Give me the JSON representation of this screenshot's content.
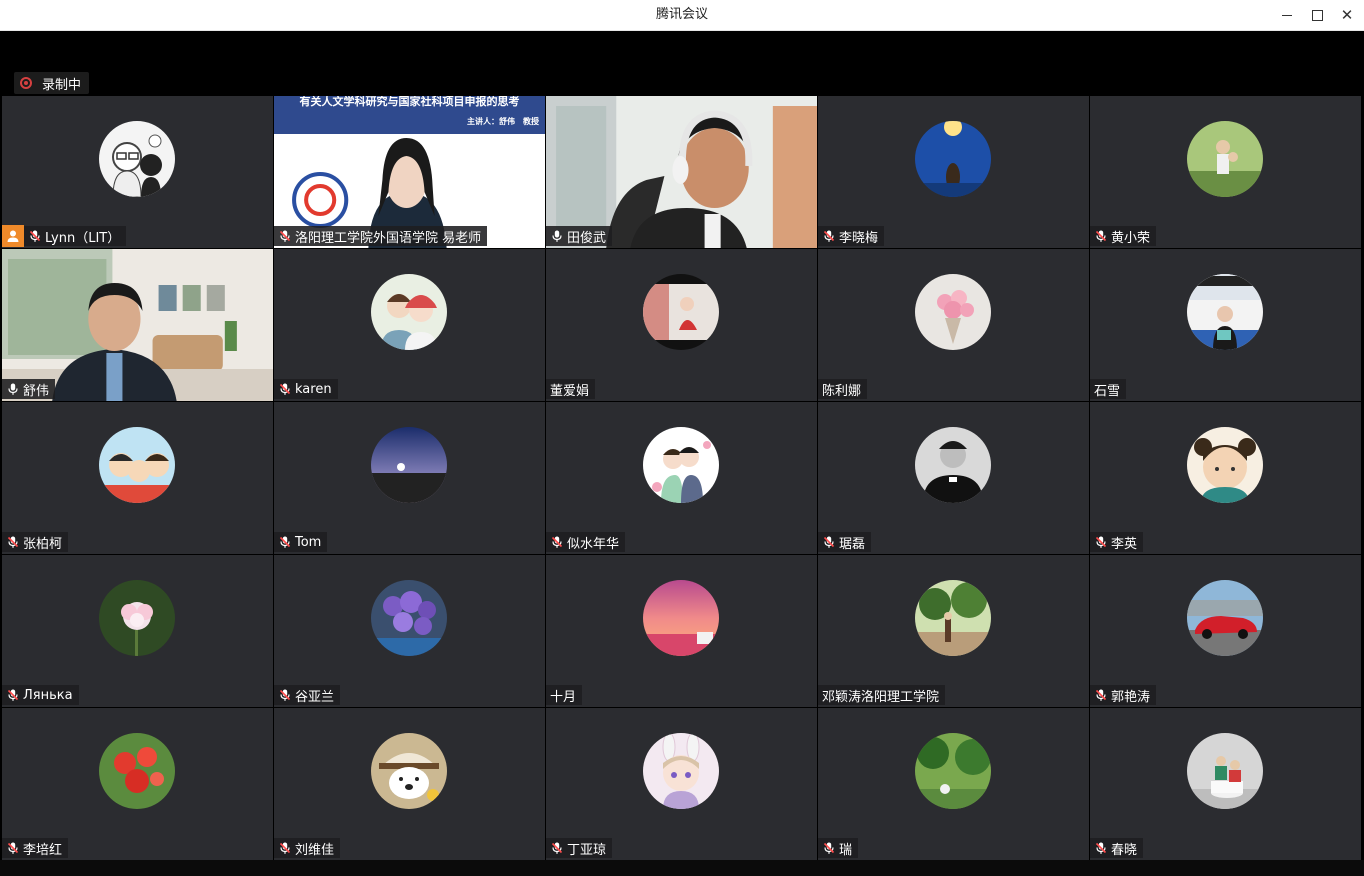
{
  "window": {
    "title": "腾讯会议"
  },
  "recording": {
    "label": "录制中",
    "color": "#d64040"
  },
  "colors": {
    "tile_bg": "#2b2c30",
    "speaking_border": "#30c368",
    "host_badge": "#ef8a2a"
  },
  "slide": {
    "title": "有关人文学科研究与国家社科项目申报的思考",
    "subtitle": "主讲人：舒伟　教授"
  },
  "participants": [
    {
      "name": "Lynn（LIT）",
      "mic": "muted",
      "host": true,
      "avatar": "cartoon-couple-avatar"
    },
    {
      "name": "洛阳理工学院外国语学院 易老师",
      "mic": "muted",
      "video": "slide-presenter"
    },
    {
      "name": "田俊武",
      "mic": "on",
      "video": "headphone-speaker",
      "speaking": true
    },
    {
      "name": "李晓梅",
      "mic": "muted",
      "avatar": "night-sky-avatar"
    },
    {
      "name": "黄小荣",
      "mic": "muted",
      "avatar": "outdoor-family-avatar"
    },
    {
      "name": "舒伟",
      "mic": "on",
      "video": "living-room-speaker"
    },
    {
      "name": "karen",
      "mic": "muted",
      "avatar": "illustrated-couple-avatar"
    },
    {
      "name": "董爱娟",
      "mic": "none",
      "avatar": "red-dress-avatar"
    },
    {
      "name": "陈利娜",
      "mic": "none",
      "avatar": "flower-bouquet-avatar"
    },
    {
      "name": "石雪",
      "mic": "none",
      "avatar": "school-sign-avatar"
    },
    {
      "name": "张柏柯",
      "mic": "muted",
      "avatar": "cartoon-family-avatar"
    },
    {
      "name": "Tom",
      "mic": "muted",
      "avatar": "sunset-silhouette-avatar"
    },
    {
      "name": "似水年华",
      "mic": "muted",
      "avatar": "wedding-cartoon-avatar"
    },
    {
      "name": "琚磊",
      "mic": "muted",
      "avatar": "bw-portrait-avatar"
    },
    {
      "name": "李英",
      "mic": "muted",
      "avatar": "cartoon-girl-avatar"
    },
    {
      "name": "Лянька",
      "mic": "muted",
      "avatar": "lotus-flower-avatar"
    },
    {
      "name": "谷亚兰",
      "mic": "muted",
      "avatar": "purple-flowers-avatar"
    },
    {
      "name": "十月",
      "mic": "none",
      "avatar": "pink-sunset-avatar"
    },
    {
      "name": "邓颖涛洛阳理工学院",
      "mic": "none",
      "avatar": "garden-trees-avatar"
    },
    {
      "name": "郭艳涛",
      "mic": "muted",
      "avatar": "red-sportscar-avatar"
    },
    {
      "name": "李培红",
      "mic": "muted",
      "avatar": "red-flowers-avatar"
    },
    {
      "name": "刘维佳",
      "mic": "muted",
      "avatar": "puppy-hat-avatar"
    },
    {
      "name": "丁亚琼",
      "mic": "muted",
      "avatar": "bunny-girl-avatar"
    },
    {
      "name": "瑞",
      "mic": "muted",
      "avatar": "green-park-avatar"
    },
    {
      "name": "春晓",
      "mic": "muted",
      "avatar": "kids-on-stool-avatar"
    }
  ]
}
